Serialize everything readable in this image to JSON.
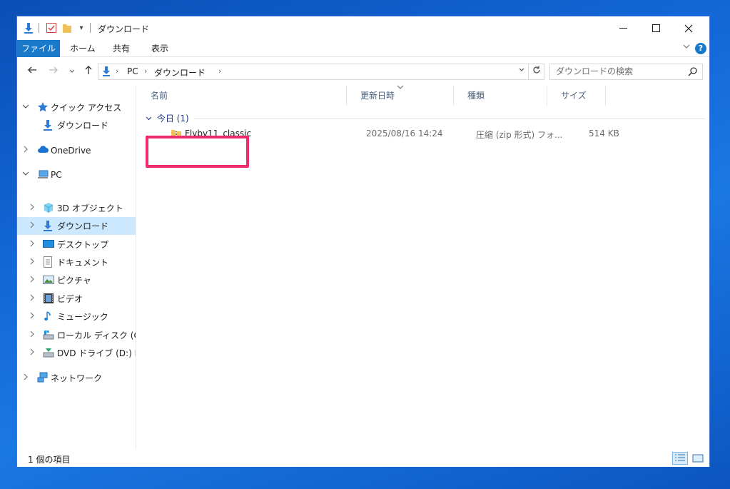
{
  "window": {
    "title": "ダウンロード",
    "quick_access_dropdown": "▾"
  },
  "ribbon": {
    "tabs": [
      {
        "label": "ファイル"
      },
      {
        "label": "ホーム"
      },
      {
        "label": "共有"
      },
      {
        "label": "表示"
      }
    ],
    "help_label": "?"
  },
  "address": {
    "crumbs": [
      "PC",
      "ダウンロード"
    ],
    "search_placeholder": "ダウンロードの検索"
  },
  "nav": {
    "items": [
      {
        "label": "クイック アクセス",
        "icon": "star-icon"
      },
      {
        "label": "ダウンロード",
        "icon": "download-arrow-icon"
      },
      {
        "label": "OneDrive",
        "icon": "cloud-icon"
      },
      {
        "label": "PC",
        "icon": "computer-icon"
      },
      {
        "label": "3D オブジェクト",
        "icon": "cube-icon"
      },
      {
        "label": "ダウンロード",
        "icon": "download-arrow-icon"
      },
      {
        "label": "デスクトップ",
        "icon": "desktop-icon"
      },
      {
        "label": "ドキュメント",
        "icon": "document-icon"
      },
      {
        "label": "ピクチャ",
        "icon": "picture-icon"
      },
      {
        "label": "ビデオ",
        "icon": "video-icon"
      },
      {
        "label": "ミュージック",
        "icon": "music-icon"
      },
      {
        "label": "ローカル ディスク (C:)",
        "icon": "disk-icon"
      },
      {
        "label": "DVD ドライブ (D:) ESD",
        "icon": "dvd-icon"
      },
      {
        "label": "ネットワーク",
        "icon": "network-icon"
      }
    ]
  },
  "content": {
    "columns": [
      "名前",
      "更新日時",
      "種類",
      "サイズ"
    ],
    "group_label": "今日 (1)",
    "files": [
      {
        "name": "Flyby11_classic",
        "modified": "2025/08/16 14:24",
        "type": "圧縮 (zip 形式) フォ...",
        "size": "514 KB",
        "icon": "zip-folder-icon"
      }
    ]
  },
  "status": {
    "item_count": "1 個の項目"
  },
  "colors": {
    "accent": "#1979ca",
    "selection": "#cce8ff",
    "highlight_box": "#ee2a6b"
  }
}
